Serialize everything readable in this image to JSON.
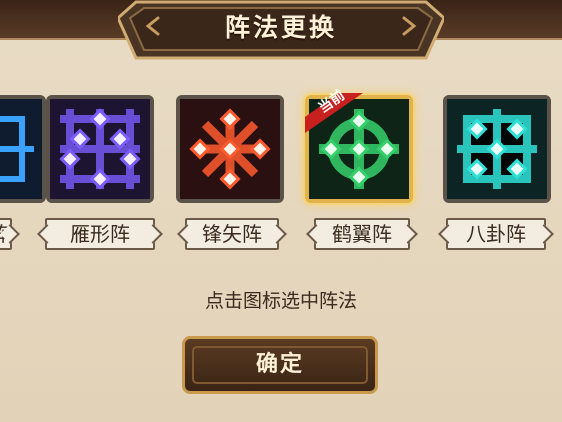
{
  "title": "阵法更换",
  "formations": [
    {
      "label": "阵",
      "color": "#3aa1ff",
      "partial": true
    },
    {
      "label": "雁形阵",
      "color": "#7b5cff"
    },
    {
      "label": "锋矢阵",
      "color": "#ff5a2e"
    },
    {
      "label": "鹤翼阵",
      "color": "#35d06b",
      "current": true,
      "badge": "当前"
    },
    {
      "label": "八卦阵",
      "color": "#2fe0d6"
    }
  ],
  "hint": "点击图标选中阵法",
  "confirm_label": "确定",
  "colors": {
    "selected_border": "#e2b34a",
    "button_gold": "#c99a4d"
  }
}
